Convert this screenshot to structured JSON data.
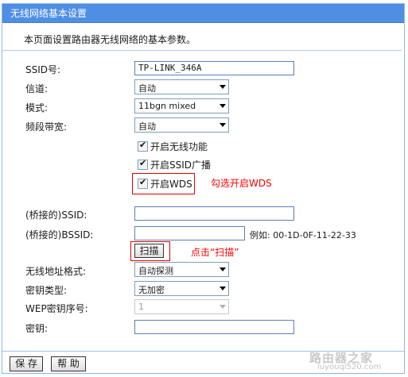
{
  "header": {
    "title": "无线网络基本设置"
  },
  "description": "本页面设置路由器无线网络的基本参数。",
  "form": {
    "ssid": {
      "label": "SSID号:",
      "value": "TP-LINK_346A"
    },
    "channel": {
      "label": "信道:",
      "value": "自动"
    },
    "mode": {
      "label": "模式:",
      "value": "11bgn mixed"
    },
    "bandwidth": {
      "label": "频段带宽:",
      "value": "自动"
    },
    "enable_wireless": {
      "label": "开启无线功能",
      "checked": true
    },
    "enable_ssid_broadcast": {
      "label": "开启SSID广播",
      "checked": true
    },
    "enable_wds": {
      "label": "开启WDS",
      "checked": true
    },
    "bridged_ssid": {
      "label": "(桥接的)SSID:",
      "value": ""
    },
    "bridged_bssid": {
      "label": "(桥接的)BSSID:",
      "value": "",
      "example": "例如: 00-1D-0F-11-22-33"
    },
    "scan_button": "扫描",
    "addr_format": {
      "label": "无线地址格式:",
      "value": "自动探测"
    },
    "key_type": {
      "label": "密钥类型:",
      "value": "无加密"
    },
    "wep_index": {
      "label": "WEP密钥序号:",
      "value": "1"
    },
    "key": {
      "label": "密钥:",
      "value": ""
    }
  },
  "annotations": {
    "wds_note": "勾选开启WDS",
    "scan_note": "点击“扫描”"
  },
  "footer": {
    "save": "保 存",
    "help": "帮 助"
  },
  "watermark": {
    "line1": "路由器之家",
    "line2": "luyouqi520.com"
  },
  "colors": {
    "title_bg": "#4f8fe3",
    "annotation": "#ff0000"
  }
}
